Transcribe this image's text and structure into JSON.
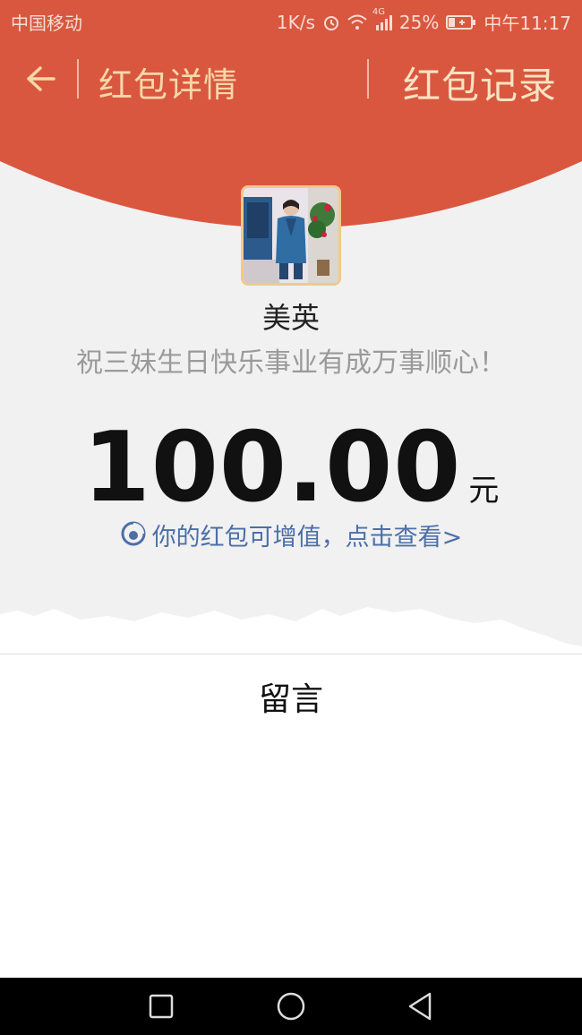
{
  "status_bar": {
    "carrier": "中国移动",
    "network_speed": "1K/s",
    "network_type": "4G",
    "battery": "25%",
    "time": "中午11:17"
  },
  "header": {
    "title": "红包详情",
    "record_link": "红包记录"
  },
  "envelope": {
    "sender_name": "美英",
    "greeting": "祝三妹生日快乐事业有成万事顺心！",
    "amount": "100.00",
    "currency_unit": "元",
    "promo_text": "你的红包可增值，点击查看>"
  },
  "message_section": {
    "label": "留言"
  },
  "colors": {
    "header_red": "#d9573f",
    "title_gold": "#f7d7a8",
    "promo_blue": "#4c6fa8"
  },
  "icons": {
    "back": "arrow-left-icon",
    "promo": "coin-growth-icon",
    "nav_recent": "square-icon",
    "nav_home": "circle-icon",
    "nav_back": "triangle-back-icon"
  }
}
